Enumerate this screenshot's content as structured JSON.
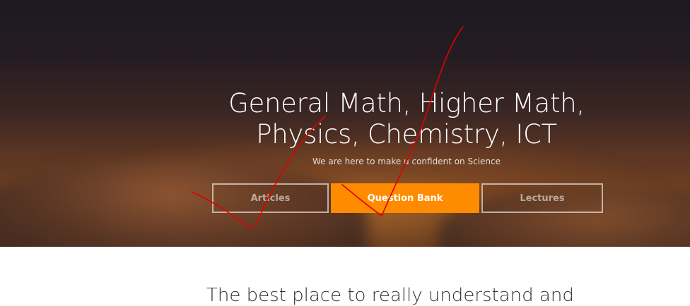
{
  "hero": {
    "heading_line1": "General Math, Higher Math,",
    "heading_line2": "Physics, Chemistry, ICT",
    "subtitle": "We are here to make u confident on Science"
  },
  "buttons": {
    "articles": "Articles",
    "question_bank": "Question Bank",
    "lectures": "Lectures"
  },
  "section": {
    "partial_text": "The best place to really understand and"
  },
  "colors": {
    "accent": "#ff8c00",
    "scribble": "#e00000"
  }
}
